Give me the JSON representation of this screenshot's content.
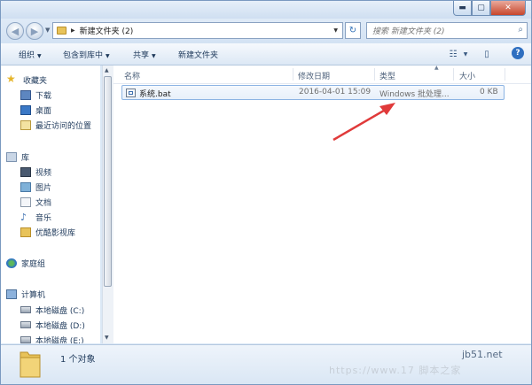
{
  "window": {
    "caption": {
      "min": "▬",
      "max": "▢",
      "close": "✕"
    }
  },
  "address": {
    "path_segment": "新建文件夹 (2)",
    "search_placeholder": "搜索 新建文件夹 (2)"
  },
  "toolbar": {
    "organize": "组织",
    "include_library": "包含到库中",
    "share": "共享",
    "new_folder": "新建文件夹",
    "help": "?"
  },
  "nav": {
    "favorites": {
      "label": "收藏夹",
      "items": [
        "下载",
        "桌面",
        "最近访问的位置"
      ]
    },
    "libraries": {
      "label": "库",
      "items": [
        "视频",
        "图片",
        "文档",
        "音乐",
        "优酷影视库"
      ]
    },
    "homegroup": "家庭组",
    "computer": {
      "label": "计算机",
      "items": [
        "本地磁盘 (C:)",
        "本地磁盘 (D:)",
        "本地磁盘 (E:)"
      ]
    }
  },
  "columns": {
    "name": "名称",
    "modified": "修改日期",
    "type": "类型",
    "size": "大小"
  },
  "files": [
    {
      "name": "系统.bat",
      "modified": "2016-04-01 15:09",
      "type": "Windows 批处理...",
      "size": "0 KB"
    }
  ],
  "details": {
    "count": "1 个对象"
  },
  "watermark": {
    "site": "jb51.net",
    "url": "https://www.17 脚本之家"
  },
  "colors": {
    "accent": "#2f6fc0",
    "arrow": "#e03a3a",
    "selection": "#e8f0fa"
  }
}
